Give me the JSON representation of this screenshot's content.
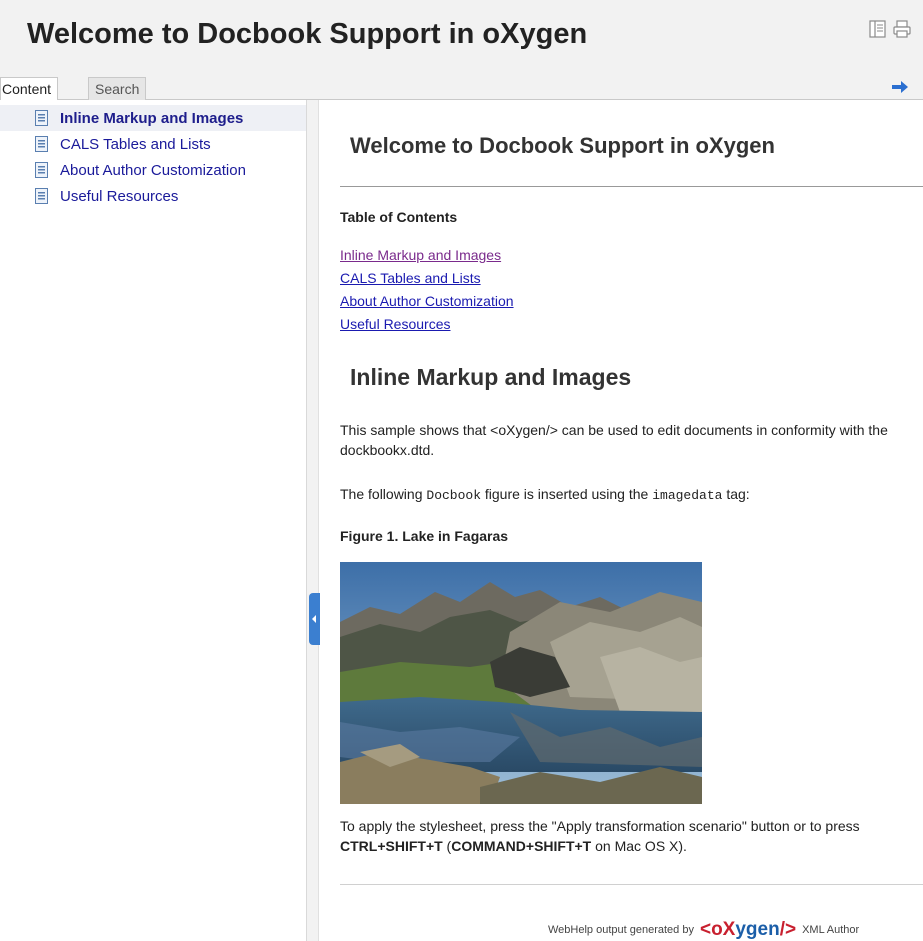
{
  "header": {
    "title": "Welcome to Docbook Support in oXygen",
    "icons": [
      "toc-toggle-icon",
      "print-icon"
    ]
  },
  "tabs": {
    "content": "Content",
    "search": "Search"
  },
  "sidebar": {
    "items": [
      {
        "label": "Inline Markup and Images",
        "selected": true
      },
      {
        "label": "CALS Tables and Lists",
        "selected": false
      },
      {
        "label": "About Author Customization",
        "selected": false
      },
      {
        "label": "Useful Resources",
        "selected": false
      }
    ]
  },
  "main": {
    "title": "Welcome to Docbook Support in oXygen",
    "toc_heading": "Table of Contents",
    "toc_links": [
      "Inline Markup and Images",
      "CALS Tables and Lists",
      "About Author Customization",
      "Useful Resources"
    ],
    "section_title": "Inline Markup and Images",
    "para1": "This sample shows that <oXygen/> can be used to edit documents in conformity with the dockbookx.dtd.",
    "para2_pre": "The following ",
    "para2_code1": "Docbook",
    "para2_mid": " figure is inserted using the ",
    "para2_code2": "imagedata",
    "para2_post": " tag:",
    "figure_title": "Figure 1. Lake in Fagaras",
    "para3_pre": "To apply the stylesheet, press the \"Apply transformation scenario\" button or to press ",
    "para3_key1": "CTRL+SHIFT+T",
    "para3_mid": " (",
    "para3_key2": "COMMAND+SHIFT+T",
    "para3_post": " on Mac OS X)."
  },
  "footer": {
    "prefix": "WebHelp output generated by",
    "logo_part1": "<o",
    "logo_part2": "X",
    "logo_part3": "ygen",
    "logo_part4": "/>",
    "suffix": "XML Author"
  },
  "colors": {
    "link": "#1a1ab0",
    "visited_link": "#7a2a8c",
    "header_bg": "#f2f2f2",
    "handle": "#3b7fd0",
    "logo_red": "#c8202f",
    "logo_blue": "#1b5ea8"
  }
}
